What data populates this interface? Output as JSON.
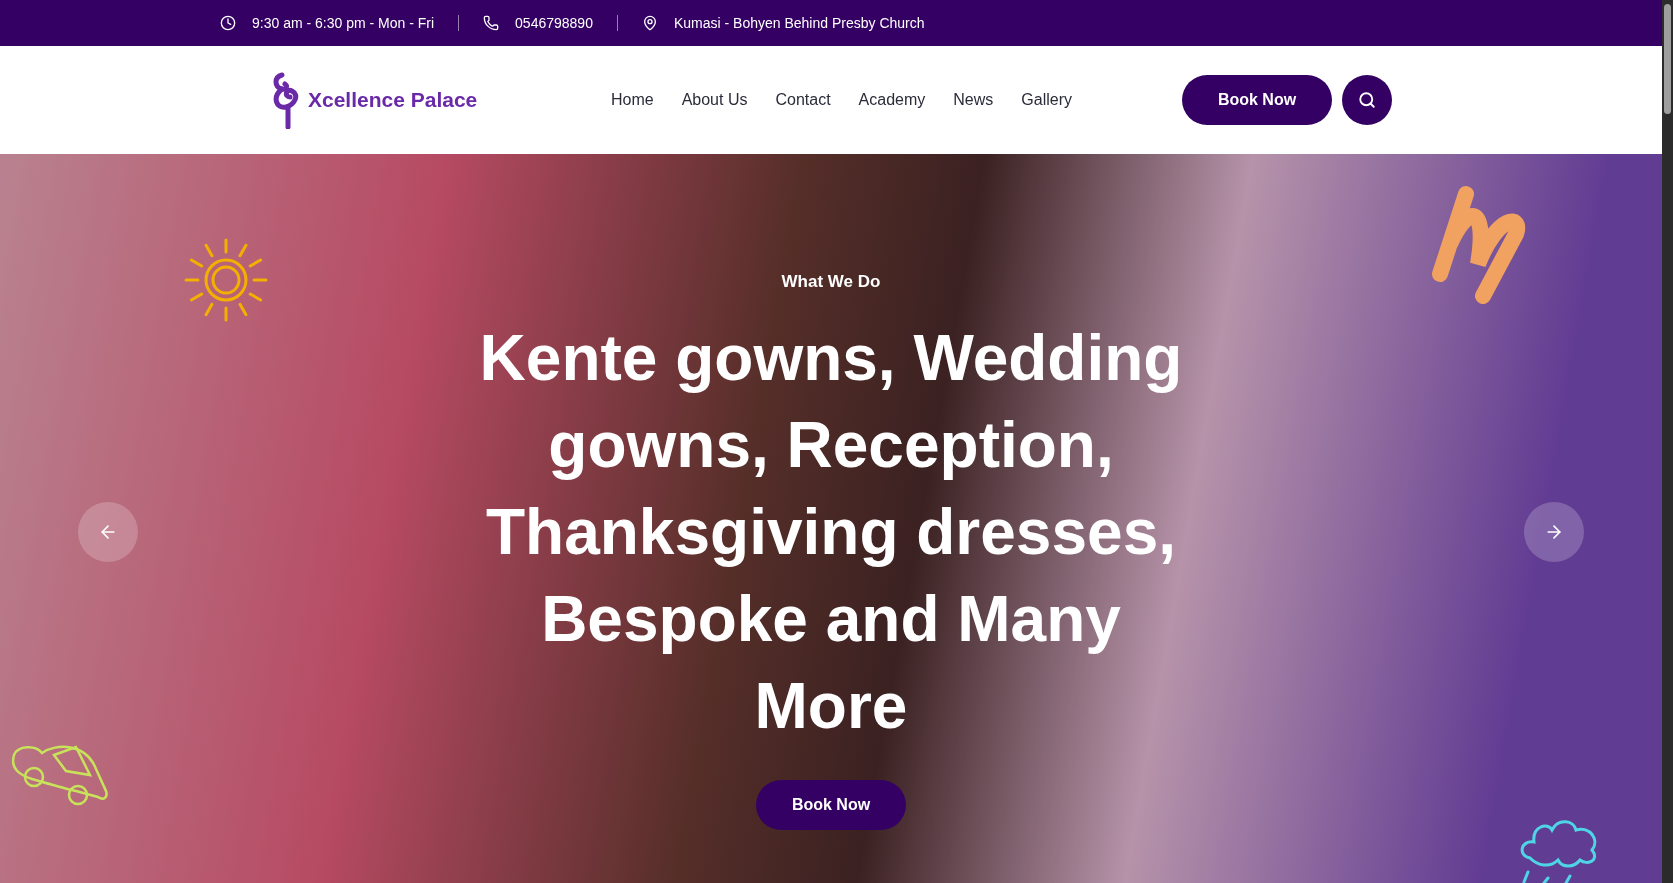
{
  "top_bar": {
    "hours": "9:30 am - 6:30 pm - Mon - Fri",
    "phone": "0546798890",
    "address": "Kumasi - Bohyen Behind Presby Church"
  },
  "header": {
    "logo_text": "Xcellence Palace",
    "nav": [
      {
        "label": "Home"
      },
      {
        "label": "About Us"
      },
      {
        "label": "Contact"
      },
      {
        "label": "Academy"
      },
      {
        "label": "News"
      },
      {
        "label": "Gallery"
      }
    ],
    "book_button": "Book Now"
  },
  "hero": {
    "eyebrow": "What We Do",
    "title": "Kente gowns, Wedding gowns, Reception, Thanksgiving dresses, Bespoke and Many More",
    "button": "Book Now"
  }
}
